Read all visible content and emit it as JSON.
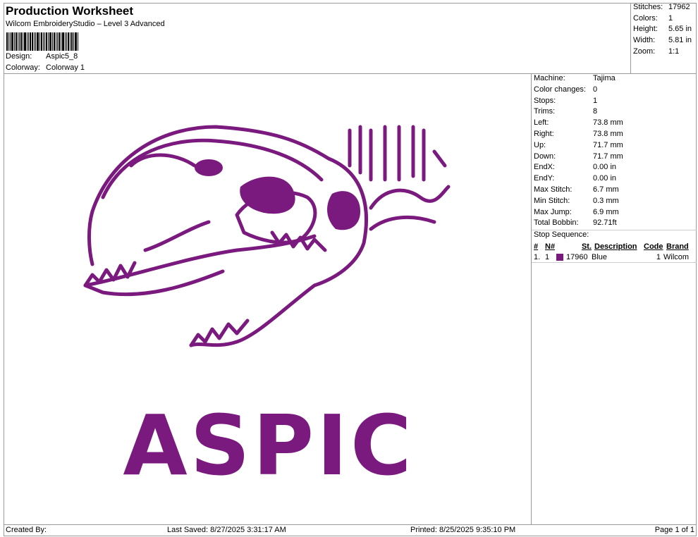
{
  "header": {
    "title": "Production Worksheet",
    "subtitle": "Wilcom EmbroideryStudio – Level 3 Advanced",
    "design_label": "Design:",
    "design_value": "Aspic5_8",
    "colorway_label": "Colorway:",
    "colorway_value": "Colorway 1"
  },
  "stats": [
    {
      "label": "Stitches:",
      "value": "17962"
    },
    {
      "label": "Colors:",
      "value": "1"
    },
    {
      "label": "Height:",
      "value": "5.65 in"
    },
    {
      "label": "Width:",
      "value": "5.81 in"
    },
    {
      "label": "Zoom:",
      "value": "1:1"
    }
  ],
  "details": [
    {
      "label": "Machine:",
      "value": "Tajima"
    },
    {
      "label": "Color changes:",
      "value": "0"
    },
    {
      "label": "Stops:",
      "value": "1"
    },
    {
      "label": "Trims:",
      "value": "8"
    },
    {
      "label": "Left:",
      "value": "73.8 mm"
    },
    {
      "label": "Right:",
      "value": "73.8 mm"
    },
    {
      "label": "Up:",
      "value": "71.7 mm"
    },
    {
      "label": "Down:",
      "value": "71.7 mm"
    },
    {
      "label": "EndX:",
      "value": "0.00 in"
    },
    {
      "label": "EndY:",
      "value": "0.00 in"
    },
    {
      "label": "Max Stitch:",
      "value": "6.7 mm"
    },
    {
      "label": "Min Stitch:",
      "value": "0.3 mm"
    },
    {
      "label": "Max Jump:",
      "value": "6.9 mm"
    },
    {
      "label": "Total Bobbin:",
      "value": "92.71ft"
    }
  ],
  "stop_sequence": {
    "title": "Stop Sequence:",
    "headers": [
      "#",
      "N#",
      "St.",
      "Description",
      "Code",
      "Brand"
    ],
    "rows": [
      {
        "num": "1.",
        "n": "1",
        "color": "#7b1a7e",
        "st": "17960",
        "description": "Blue",
        "code": "1",
        "brand": "Wilcom"
      }
    ]
  },
  "design": {
    "text": "ASPIC",
    "thread_color": "#7b1a7e"
  },
  "footer": {
    "created_by": "Created By:",
    "last_saved": "Last Saved: 8/27/2025 3:31:17 AM",
    "printed": "Printed: 8/25/2025 9:35:10 PM",
    "page": "Page 1 of 1"
  }
}
